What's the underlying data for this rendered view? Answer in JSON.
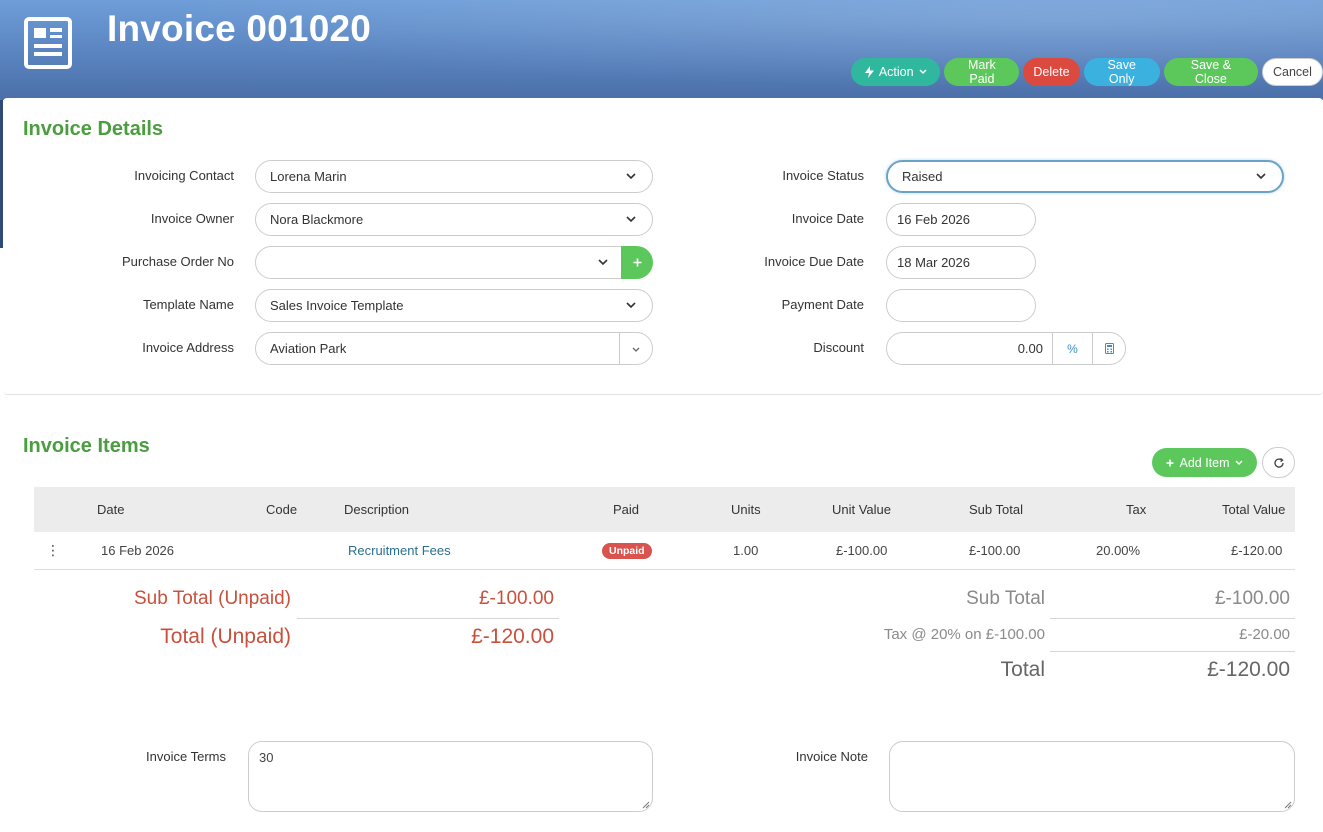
{
  "header": {
    "title": "Invoice 001020",
    "actions": {
      "action": "Action",
      "mark_paid": "Mark Paid",
      "delete": "Delete",
      "save_only": "Save Only",
      "save_close": "Save & Close",
      "cancel": "Cancel"
    }
  },
  "details": {
    "title": "Invoice Details",
    "invoicing_contact": {
      "label": "Invoicing Contact",
      "value": "Lorena Marin"
    },
    "invoice_owner": {
      "label": "Invoice Owner",
      "value": "Nora Blackmore"
    },
    "purchase_order_no": {
      "label": "Purchase Order No",
      "value": ""
    },
    "template_name": {
      "label": "Template Name",
      "value": "Sales Invoice Template"
    },
    "invoice_address": {
      "label": "Invoice Address",
      "value": "Aviation Park"
    },
    "invoice_status": {
      "label": "Invoice Status",
      "value": "Raised"
    },
    "invoice_date": {
      "label": "Invoice Date",
      "value": "16 Feb 2026"
    },
    "invoice_due_date": {
      "label": "Invoice Due Date",
      "value": "18 Mar 2026"
    },
    "payment_date": {
      "label": "Payment Date",
      "value": ""
    },
    "discount": {
      "label": "Discount",
      "value": "0.00",
      "percent_symbol": "%"
    }
  },
  "items": {
    "title": "Invoice Items",
    "add_item": "Add Item",
    "columns": {
      "date": "Date",
      "code": "Code",
      "description": "Description",
      "paid": "Paid",
      "units": "Units",
      "unit_value": "Unit Value",
      "sub_total": "Sub Total",
      "tax": "Tax",
      "total_value": "Total Value"
    },
    "rows": [
      {
        "date": "16 Feb 2026",
        "code": "",
        "description": "Recruitment Fees",
        "paid": "Unpaid",
        "units": "1.00",
        "unit_value": "£-100.00",
        "sub_total": "£-100.00",
        "tax": "20.00%",
        "total_value": "£-120.00"
      }
    ]
  },
  "totals": {
    "unpaid_sub_label": "Sub Total (Unpaid)",
    "unpaid_sub_value": "£-100.00",
    "unpaid_total_label": "Total (Unpaid)",
    "unpaid_total_value": "£-120.00",
    "sub_label": "Sub Total",
    "sub_value": "£-100.00",
    "tax_label": "Tax @ 20% on £-100.00",
    "tax_value": "£-20.00",
    "total_label": "Total",
    "total_value": "£-120.00"
  },
  "footer": {
    "terms_label": "Invoice Terms",
    "terms_value": "30",
    "note_label": "Invoice Note",
    "note_value": ""
  },
  "colors": {
    "section_title": "#4a9e3f",
    "unpaid_red": "#c9503c",
    "action_teal": "#2fb89d",
    "green": "#5cc85c",
    "delete_red": "#dc4a3f",
    "save_blue": "#3bb1e0"
  },
  "icons": {
    "logo": "invoice-document-icon",
    "action": "lightning-icon",
    "add": "plus-icon",
    "refresh": "refresh-icon",
    "row_menu": "kebab-menu-icon",
    "discount_calc": "calculator-icon"
  }
}
